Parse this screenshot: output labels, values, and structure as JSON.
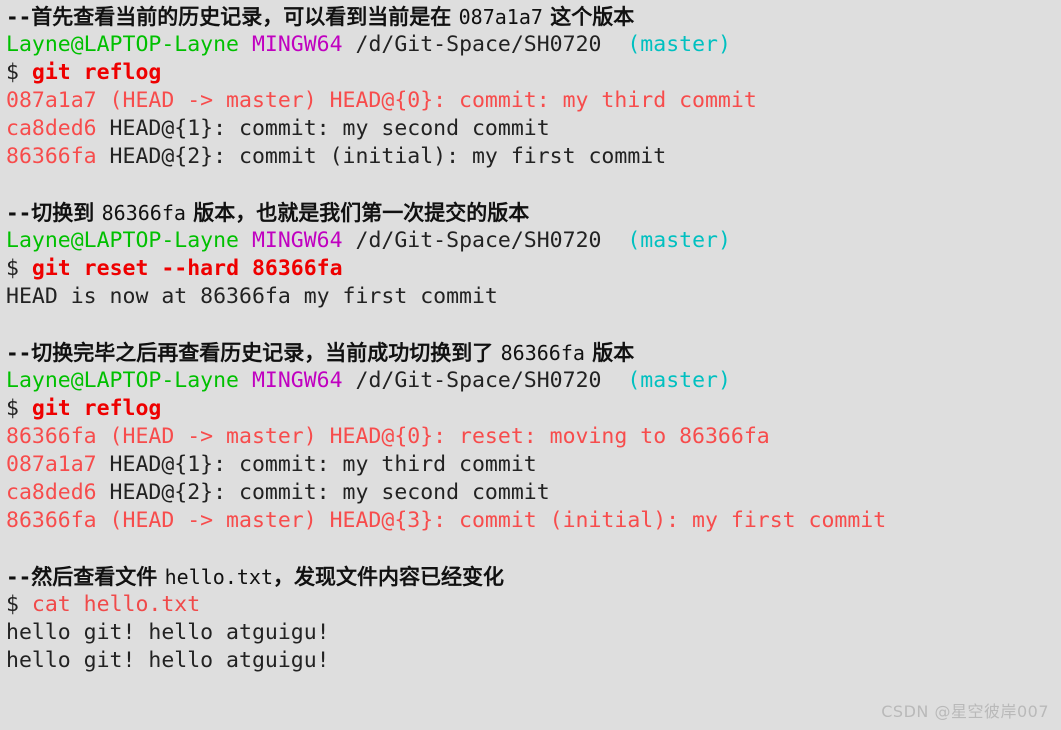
{
  "terminal": {
    "background_color": "#dedede",
    "colors": {
      "green": "#00c000",
      "magenta": "#c000c0",
      "cyan": "#00c0c0",
      "bold_red": "#ee0000",
      "light_red": "#f74c4c",
      "default_text": "#222222"
    },
    "lines": [
      {
        "id": "comment-1",
        "type": "comment",
        "dashes": "--",
        "text_a": "首先查看当前的历史记录，可以看到当前是在 ",
        "mono": "087a1a7",
        "text_b": " 这个版本"
      },
      {
        "id": "prompt-1",
        "type": "prompt",
        "user_host": "Layne@LAPTOP-Layne",
        "shell": "MINGW64",
        "path": "/d/Git-Space/SH0720",
        "branch": "(master)"
      },
      {
        "id": "command-1",
        "type": "command",
        "sigil": "$",
        "command": "git reflog"
      },
      {
        "id": "output-1",
        "type": "output-red",
        "text": "087a1a7 (HEAD -> master) HEAD@{0}: commit: my third commit"
      },
      {
        "id": "output-2",
        "type": "output-hash",
        "hash": "ca8ded6",
        "rest": " HEAD@{1}: commit: my second commit"
      },
      {
        "id": "output-3",
        "type": "output-hash",
        "hash": "86366fa",
        "rest": " HEAD@{2}: commit (initial): my first commit"
      },
      {
        "id": "blank-1",
        "type": "blank"
      },
      {
        "id": "comment-2",
        "type": "comment",
        "dashes": "--",
        "text_a": "切换到 ",
        "mono": "86366fa",
        "text_b": " 版本，也就是我们第一次提交的版本"
      },
      {
        "id": "prompt-2",
        "type": "prompt",
        "user_host": "Layne@LAPTOP-Layne",
        "shell": "MINGW64",
        "path": "/d/Git-Space/SH0720",
        "branch": "(master)"
      },
      {
        "id": "command-2",
        "type": "command",
        "sigil": "$",
        "command": "git reset --hard 86366fa"
      },
      {
        "id": "output-4",
        "type": "output-plain",
        "text": "HEAD is now at 86366fa my first commit"
      },
      {
        "id": "blank-2",
        "type": "blank"
      },
      {
        "id": "comment-3",
        "type": "comment",
        "dashes": "--",
        "text_a": "切换完毕之后再查看历史记录，当前成功切换到了 ",
        "mono": "86366fa",
        "text_b": " 版本"
      },
      {
        "id": "prompt-3",
        "type": "prompt",
        "user_host": "Layne@LAPTOP-Layne",
        "shell": "MINGW64",
        "path": "/d/Git-Space/SH0720",
        "branch": "(master)"
      },
      {
        "id": "command-3",
        "type": "command",
        "sigil": "$",
        "command": "git reflog"
      },
      {
        "id": "output-5",
        "type": "output-red",
        "text": "86366fa (HEAD -> master) HEAD@{0}: reset: moving to 86366fa"
      },
      {
        "id": "output-6",
        "type": "output-hash",
        "hash": "087a1a7",
        "rest": " HEAD@{1}: commit: my third commit"
      },
      {
        "id": "output-7",
        "type": "output-hash",
        "hash": "ca8ded6",
        "rest": " HEAD@{2}: commit: my second commit"
      },
      {
        "id": "output-8",
        "type": "output-red",
        "text": "86366fa (HEAD -> master) HEAD@{3}: commit (initial): my first commit"
      },
      {
        "id": "blank-3",
        "type": "blank"
      },
      {
        "id": "comment-4",
        "type": "comment",
        "dashes": "--",
        "text_a": "然后查看文件 ",
        "mono": "hello.txt",
        "text_b": "，发现文件内容已经变化"
      },
      {
        "id": "command-4",
        "type": "command-plain",
        "sigil": "$",
        "command": "cat hello.txt"
      },
      {
        "id": "output-9",
        "type": "output-plain",
        "text": "hello git! hello atguigu!"
      },
      {
        "id": "output-10",
        "type": "output-plain",
        "text": "hello git! hello atguigu!"
      }
    ]
  },
  "watermark": {
    "text": "CSDN @星空彼岸007"
  }
}
